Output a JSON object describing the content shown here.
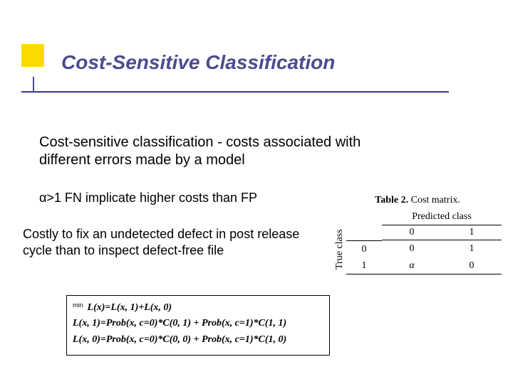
{
  "title": "Cost-Sensitive Classification",
  "body": {
    "p1": "Cost-sensitive  classification - costs associated with different errors made by a model",
    "p2_alpha": "α",
    "p2_rest": ">1   FN implicate higher costs than FP",
    "p3": "Costly to fix an undetected defect in post release cycle than to inspect defect-free file"
  },
  "equations": {
    "min_label": "min",
    "line1": "L(x)=L(x, 1)+L(x, 0)",
    "line2": "L(x, 1)=Prob(x, c=0)*C(0, 1) + Prob(x, c=1)*C(1, 1)",
    "line3": "L(x, 0)=Prob(x, c=0)*C(0, 0) + Prob(x, c=1)*C(1, 0)"
  },
  "cost_matrix": {
    "caption_label": "Table 2.",
    "caption_text": " Cost matrix.",
    "pred_header": "Predicted class",
    "true_header": "True class",
    "col0": "0",
    "col1": "1",
    "row0": "0",
    "row1": "1",
    "c00": "0",
    "c01": "1",
    "c10": "α",
    "c11": "0"
  },
  "chart_data": {
    "type": "table",
    "title": "Table 2. Cost matrix.",
    "row_label": "True class",
    "col_label": "Predicted class",
    "columns": [
      "0",
      "1"
    ],
    "rows": [
      "0",
      "1"
    ],
    "cells": [
      [
        "0",
        "1"
      ],
      [
        "α",
        "0"
      ]
    ]
  }
}
